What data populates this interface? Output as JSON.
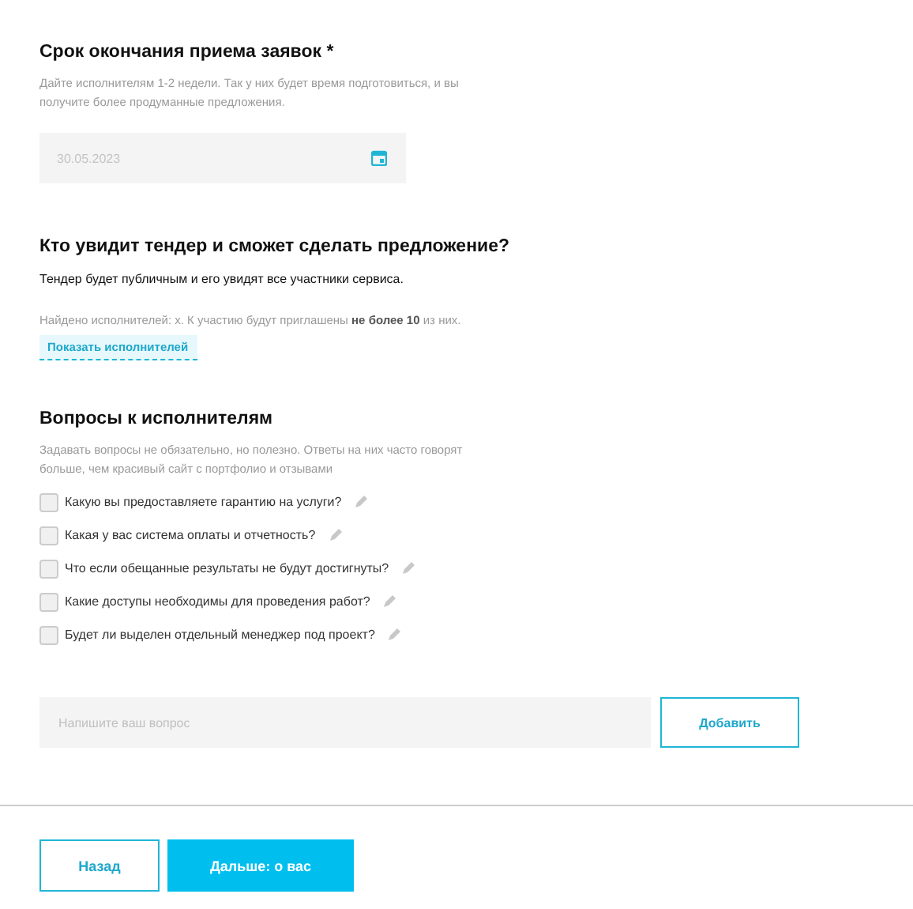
{
  "deadline": {
    "title": "Срок окончания приема заявок *",
    "hint": "Дайте исполнителям 1-2 недели. Так у них будет время подготовиться, и вы получите более продуманные предложения.",
    "date": "30.05.2023"
  },
  "visibility": {
    "title": "Кто увидит тендер и сможет сделать предложение?",
    "text": "Тендер будет публичным и его увидят все участники сервиса.",
    "found": "Найдено исполнителей: x. К участию будут приглашены **не более 10** из них.",
    "link": "Показать исполнителей"
  },
  "questions": {
    "title": "Вопросы к исполнителям",
    "hint": "Задавать вопросы не обязательно, но полезно. Ответы на них часто говорят больше, чем красивый сайт с портфолио и отзывами",
    "items": [
      {
        "label": "Какую вы предоставляете гарантию на услуги?",
        "checked": false
      },
      {
        "label": "Какая у вас система оплаты и отчетность?",
        "checked": false
      },
      {
        "label": "Что если обещанные результаты не будут достигнуты?",
        "checked": false
      },
      {
        "label": "Какие доступы необходимы для проведения работ?",
        "checked": false
      },
      {
        "label": "Будет ли выделен отдельный менеджер под проект?",
        "checked": false
      }
    ],
    "placeholder": "Напишите ваш вопрос",
    "add": "Добавить"
  },
  "footer": {
    "back": "Назад",
    "next": "Дальше: о вас"
  }
}
